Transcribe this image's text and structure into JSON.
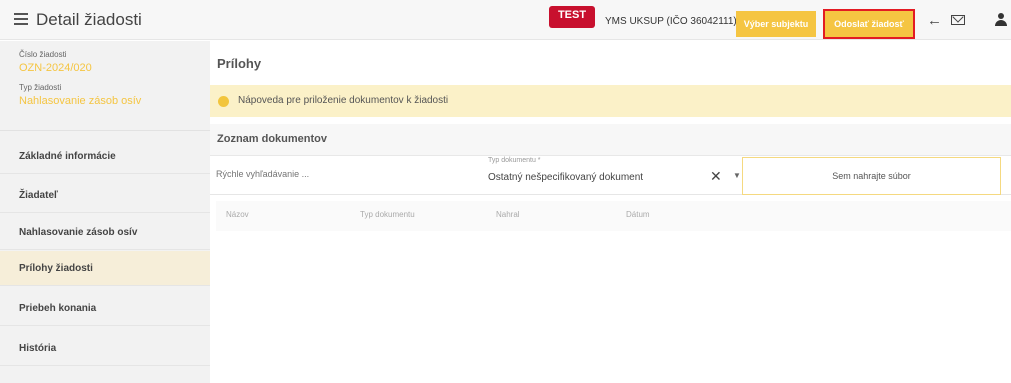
{
  "header": {
    "title": "Detail žiadosti",
    "test_badge": "TEST",
    "subject": "YMS UKSUP (IČO 36042111)",
    "btn_select_subject": "Výber subjektu",
    "btn_send_request": "Odoslať žiadosť"
  },
  "sidebar": {
    "request_number_label": "Číslo žiadosti",
    "request_number": "OZN-2024/020",
    "request_type_label": "Typ žiadosti",
    "request_type": "Nahlasovanie zásob osív",
    "items": [
      {
        "label": "Základné informácie",
        "active": false
      },
      {
        "label": "Žiadateľ",
        "active": false
      },
      {
        "label": "Nahlasovanie zásob osív",
        "active": false
      },
      {
        "label": "Prílohy žiadosti",
        "active": true
      },
      {
        "label": "Priebeh konania",
        "active": false
      },
      {
        "label": "História",
        "active": false
      }
    ]
  },
  "main": {
    "section_title": "Prílohy",
    "help_text": "Nápoveda pre priloženie dokumentov k žiadosti",
    "list_title": "Zoznam dokumentov",
    "search_placeholder": "Rýchle vyhľadávanie ...",
    "doc_type_label": "Typ dokumentu *",
    "doc_type_value": "Ostatný nešpecifikovaný dokument",
    "upload_text": "Sem nahrajte súbor",
    "columns": [
      "Názov",
      "Typ dokumentu",
      "Nahral",
      "Dátum"
    ]
  },
  "colors": {
    "accent": "#f5c542",
    "badge": "#c8102e",
    "highlight_border": "#e31b23",
    "active_nav": "#f6eed9"
  }
}
